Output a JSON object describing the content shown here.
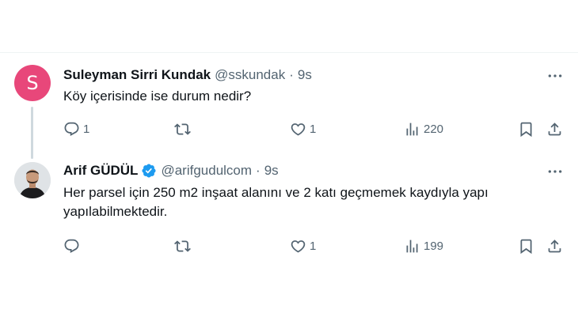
{
  "tweets": [
    {
      "author_name": "Suleyman Sirri Kundak",
      "handle": "@sskundak",
      "separator": "·",
      "time": "9s",
      "avatar_letter": "S",
      "avatar_color": "#e8477a",
      "verified": false,
      "text": "Köy içerisinde ise durum nedir?",
      "reply_count": "1",
      "retweet_count": "",
      "like_count": "1",
      "view_count": "220"
    },
    {
      "author_name": "Arif GÜDÜL",
      "handle": "@arifgudulcom",
      "separator": "·",
      "time": "9s",
      "verified": true,
      "verified_color": "#1d9bf0",
      "text": "Her parsel için 250 m2 inşaat alanını ve 2 katı geçmemek kaydıyla yapı yapılabilmektedir.",
      "reply_count": "",
      "retweet_count": "",
      "like_count": "1",
      "view_count": "199"
    }
  ],
  "icons": {
    "more": "more-horizontal-icon",
    "reply": "reply-bubble-icon",
    "retweet": "retweet-arrows-icon",
    "like": "heart-icon",
    "views": "views-bar-chart-icon",
    "bookmark": "bookmark-icon",
    "share": "share-upload-icon",
    "verified": "verified-badge-icon"
  }
}
